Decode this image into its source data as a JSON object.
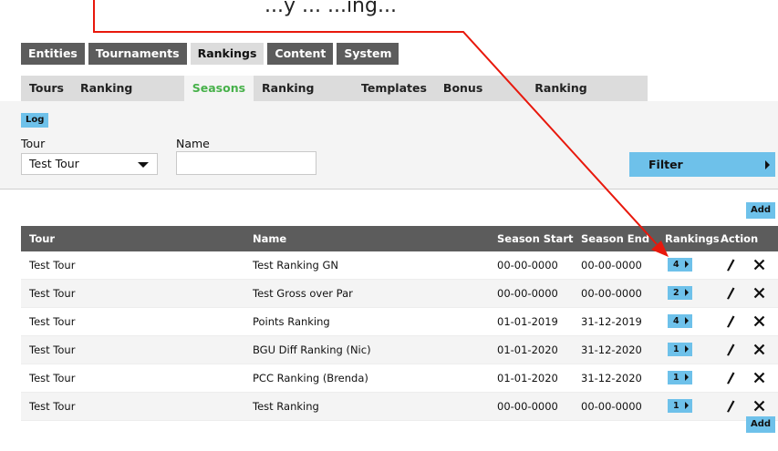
{
  "caption": "...y ... ...ing...",
  "top_tabs": [
    "Entities",
    "Tournaments",
    "Rankings",
    "Content",
    "System"
  ],
  "top_tab_active": "Rankings",
  "sub_tabs": [
    "Tours",
    "Ranking iFrames",
    "Seasons",
    "Ranking Types",
    "Templates",
    "Bonus Tables",
    "Ranking Summary"
  ],
  "sub_tab_active": "Seasons",
  "filter": {
    "log_label": "Log",
    "tour_label": "Tour",
    "tour_value": "Test Tour",
    "name_label": "Name",
    "name_value": "",
    "filter_button": "Filter"
  },
  "add_label": "Add",
  "table": {
    "headers": [
      "Tour",
      "Name",
      "Season Start",
      "Season End",
      "Rankings",
      "Action"
    ],
    "rows": [
      {
        "tour": "Test Tour",
        "name": "Test Ranking GN",
        "start": "00-00-0000",
        "end": "00-00-0000",
        "rankings": "4"
      },
      {
        "tour": "Test Tour",
        "name": "Test Gross over Par",
        "start": "00-00-0000",
        "end": "00-00-0000",
        "rankings": "2"
      },
      {
        "tour": "Test Tour",
        "name": "Points Ranking",
        "start": "01-01-2019",
        "end": "31-12-2019",
        "rankings": "4"
      },
      {
        "tour": "Test Tour",
        "name": "BGU Diff Ranking (Nic)",
        "start": "01-01-2020",
        "end": "31-12-2020",
        "rankings": "1"
      },
      {
        "tour": "Test Tour",
        "name": "PCC Ranking (Brenda)",
        "start": "01-01-2020",
        "end": "31-12-2020",
        "rankings": "1"
      },
      {
        "tour": "Test Tour",
        "name": "Test Ranking",
        "start": "00-00-0000",
        "end": "00-00-0000",
        "rankings": "1"
      }
    ]
  },
  "colors": {
    "accent": "#6ec1ea",
    "active_tab_text": "#47b14a",
    "annotation": "#e8180c"
  }
}
